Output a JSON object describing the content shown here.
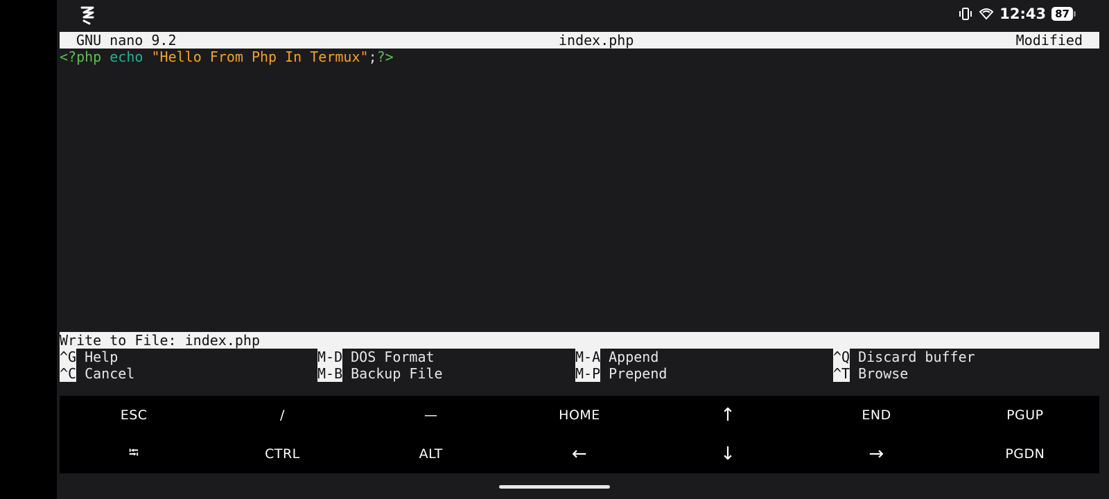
{
  "status_bar": {
    "time": "12:43",
    "battery": "87",
    "icons": [
      "app-logo-icon",
      "vibrate-icon",
      "wifi-icon",
      "battery-icon"
    ]
  },
  "nano": {
    "version": "GNU nano 9.2",
    "filename": "index.php",
    "state": "Modified",
    "code": {
      "open_tag": "<?php",
      "keyword": "echo",
      "space": " ",
      "string": "\"Hello From Php In Termux\"",
      "semicolon": ";",
      "close_tag": "?>"
    },
    "prompt": "Write to File: index.php",
    "shortcuts": [
      {
        "key": "^G",
        "label": "Help"
      },
      {
        "key": "M-D",
        "label": "DOS Format"
      },
      {
        "key": "M-A",
        "label": "Append"
      },
      {
        "key": "^Q",
        "label": "Discard buffer"
      },
      {
        "key": "^C",
        "label": "Cancel"
      },
      {
        "key": "M-B",
        "label": "Backup File"
      },
      {
        "key": "M-P",
        "label": "Prepend"
      },
      {
        "key": "^T",
        "label": "Browse"
      }
    ]
  },
  "extra_keys": {
    "row1": [
      "ESC",
      "/",
      "—",
      "HOME",
      "↑",
      "END",
      "PGUP"
    ],
    "row2": [
      "⭾",
      "CTRL",
      "ALT",
      "←",
      "↓",
      "→",
      "PGDN"
    ]
  },
  "colors": {
    "php_tag": "#55c24a",
    "keyword": "#1fb191",
    "string": "#f4a12a",
    "background": "#1b1b1d"
  }
}
